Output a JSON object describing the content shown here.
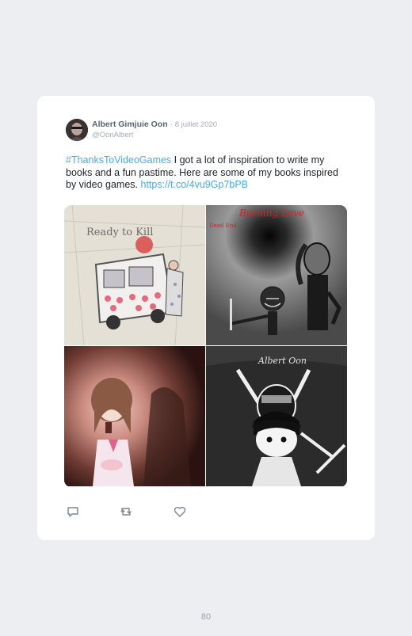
{
  "tweet": {
    "author": {
      "display_name": "Albert Gimjuie Oon",
      "separator": "·",
      "date": "8 juillet 2020",
      "handle": "@OonAlbert"
    },
    "text": {
      "hashtag": "#ThanksToVideoGames",
      "body": " I got a lot of inspiration to write my books and a fun pastime. Here are some of my books inspired by video games. ",
      "link": "https://t.co/4vu9Gp7bPB"
    },
    "images": [
      {
        "icon": "artwork-ready-to-kill",
        "caption": "Ready to Kill"
      },
      {
        "icon": "artwork-burning-love",
        "caption": "Burning Love",
        "tag": "Dead End"
      },
      {
        "icon": "artwork-anime-girl"
      },
      {
        "icon": "artwork-albert-oon",
        "caption": "Albert Oon"
      }
    ],
    "actions": [
      {
        "icon": "reply-icon"
      },
      {
        "icon": "retweet-icon"
      },
      {
        "icon": "like-icon"
      }
    ]
  },
  "page": {
    "number": "80"
  },
  "colors": {
    "background": "#eceef1",
    "card": "#ffffff",
    "link": "#4fa8e6",
    "name": "#5b6470",
    "muted": "#a7adb5"
  }
}
